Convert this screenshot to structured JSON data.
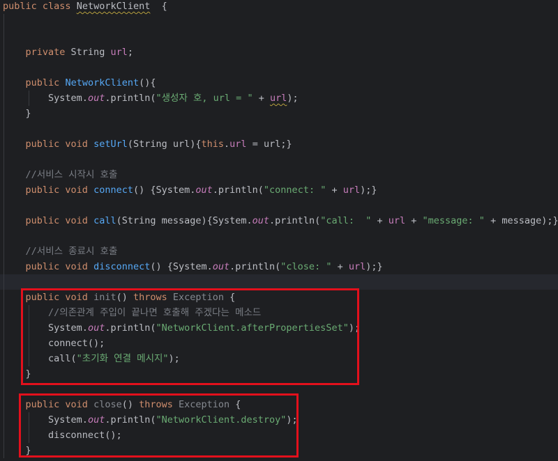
{
  "editor": {
    "language": "java",
    "colors": {
      "background": "#1e1f22",
      "keyword": "#cf8e6d",
      "function": "#56a8f5",
      "field": "#c77dbb",
      "string": "#6aab73",
      "comment": "#7a7e85",
      "unused": "#868a91",
      "text": "#bcbec4",
      "highlight_box": "#e3101c"
    },
    "lines": [
      {
        "tokens": [
          {
            "t": "public",
            "c": "kw"
          },
          {
            "t": " ",
            "c": "tx"
          },
          {
            "t": "class",
            "c": "kw"
          },
          {
            "t": " ",
            "c": "tx"
          },
          {
            "t": "NetworkClient",
            "c": "tx",
            "wavy": true
          },
          {
            "t": "  {",
            "c": "tx"
          }
        ]
      },
      {
        "tokens": []
      },
      {
        "tokens": []
      },
      {
        "tokens": [
          {
            "t": "    "
          },
          {
            "t": "private",
            "c": "kw"
          },
          {
            "t": " String ",
            "c": "tx"
          },
          {
            "t": "url",
            "c": "fld"
          },
          {
            "t": ";",
            "c": "tx"
          }
        ]
      },
      {
        "tokens": []
      },
      {
        "tokens": [
          {
            "t": "    "
          },
          {
            "t": "public",
            "c": "kw"
          },
          {
            "t": " ",
            "c": "tx"
          },
          {
            "t": "NetworkClient",
            "c": "fn"
          },
          {
            "t": "(){",
            "c": "tx"
          }
        ]
      },
      {
        "tokens": [
          {
            "t": "        "
          },
          {
            "t": "System.",
            "c": "tx"
          },
          {
            "t": "out",
            "c": "st"
          },
          {
            "t": ".println(",
            "c": "tx"
          },
          {
            "t": "\"생성자 호, url = \"",
            "c": "str"
          },
          {
            "t": " + ",
            "c": "tx"
          },
          {
            "t": "url",
            "c": "fld",
            "wavy": true
          },
          {
            "t": ");",
            "c": "tx"
          }
        ]
      },
      {
        "tokens": [
          {
            "t": "    "
          },
          {
            "t": "}",
            "c": "tx"
          }
        ]
      },
      {
        "tokens": []
      },
      {
        "tokens": [
          {
            "t": "    "
          },
          {
            "t": "public void ",
            "c": "kw"
          },
          {
            "t": "setUrl",
            "c": "fn"
          },
          {
            "t": "(String url){",
            "c": "tx"
          },
          {
            "t": "this",
            "c": "kw"
          },
          {
            "t": ".",
            "c": "tx"
          },
          {
            "t": "url",
            "c": "fld"
          },
          {
            "t": " = url;}",
            "c": "tx"
          }
        ]
      },
      {
        "tokens": []
      },
      {
        "tokens": [
          {
            "t": "    "
          },
          {
            "t": "//서비스 시작시 호출",
            "c": "cm"
          }
        ]
      },
      {
        "tokens": [
          {
            "t": "    "
          },
          {
            "t": "public void ",
            "c": "kw"
          },
          {
            "t": "connect",
            "c": "fn"
          },
          {
            "t": "() {System.",
            "c": "tx"
          },
          {
            "t": "out",
            "c": "st"
          },
          {
            "t": ".println(",
            "c": "tx"
          },
          {
            "t": "\"connect: \"",
            "c": "str"
          },
          {
            "t": " + ",
            "c": "tx"
          },
          {
            "t": "url",
            "c": "fld"
          },
          {
            "t": ");}",
            "c": "tx"
          }
        ]
      },
      {
        "tokens": []
      },
      {
        "tokens": [
          {
            "t": "    "
          },
          {
            "t": "public void ",
            "c": "kw"
          },
          {
            "t": "call",
            "c": "fn"
          },
          {
            "t": "(String message){System.",
            "c": "tx"
          },
          {
            "t": "out",
            "c": "st"
          },
          {
            "t": ".println(",
            "c": "tx"
          },
          {
            "t": "\"call:  \"",
            "c": "str"
          },
          {
            "t": " + ",
            "c": "tx"
          },
          {
            "t": "url",
            "c": "fld"
          },
          {
            "t": " + ",
            "c": "tx"
          },
          {
            "t": "\"message: \"",
            "c": "str"
          },
          {
            "t": " + message);}",
            "c": "tx"
          }
        ]
      },
      {
        "tokens": []
      },
      {
        "tokens": [
          {
            "t": "    "
          },
          {
            "t": "//서비스 종료시 호출",
            "c": "cm"
          }
        ]
      },
      {
        "tokens": [
          {
            "t": "    "
          },
          {
            "t": "public void ",
            "c": "kw"
          },
          {
            "t": "disconnect",
            "c": "fn"
          },
          {
            "t": "() {System.",
            "c": "tx"
          },
          {
            "t": "out",
            "c": "st"
          },
          {
            "t": ".println(",
            "c": "tx"
          },
          {
            "t": "\"close: \"",
            "c": "str"
          },
          {
            "t": " + ",
            "c": "tx"
          },
          {
            "t": "url",
            "c": "fld"
          },
          {
            "t": ");}",
            "c": "tx"
          }
        ]
      },
      {
        "tokens": [],
        "current": true
      },
      {
        "tokens": [
          {
            "t": "    "
          },
          {
            "t": "public void ",
            "c": "kw"
          },
          {
            "t": "init",
            "c": "un"
          },
          {
            "t": "() ",
            "c": "tx"
          },
          {
            "t": "throws ",
            "c": "kw"
          },
          {
            "t": "Exception",
            "c": "un"
          },
          {
            "t": " {",
            "c": "tx"
          }
        ]
      },
      {
        "tokens": [
          {
            "t": "        "
          },
          {
            "t": "//의존관계 주입이 끝나면 호출해 주겠다는 메소드",
            "c": "cm"
          }
        ]
      },
      {
        "tokens": [
          {
            "t": "        "
          },
          {
            "t": "System.",
            "c": "tx"
          },
          {
            "t": "out",
            "c": "st"
          },
          {
            "t": ".println(",
            "c": "tx"
          },
          {
            "t": "\"NetworkClient.afterPropertiesSet\"",
            "c": "str"
          },
          {
            "t": ");",
            "c": "tx"
          }
        ]
      },
      {
        "tokens": [
          {
            "t": "        "
          },
          {
            "t": "connect();",
            "c": "tx"
          }
        ]
      },
      {
        "tokens": [
          {
            "t": "        "
          },
          {
            "t": "call(",
            "c": "tx"
          },
          {
            "t": "\"초기화 연결 메시지\"",
            "c": "str"
          },
          {
            "t": ");",
            "c": "tx"
          }
        ]
      },
      {
        "tokens": [
          {
            "t": "    "
          },
          {
            "t": "}",
            "c": "tx"
          }
        ]
      },
      {
        "tokens": []
      },
      {
        "tokens": [
          {
            "t": "    "
          },
          {
            "t": "public void ",
            "c": "kw"
          },
          {
            "t": "close",
            "c": "un"
          },
          {
            "t": "() ",
            "c": "tx"
          },
          {
            "t": "throws ",
            "c": "kw"
          },
          {
            "t": "Exception",
            "c": "un"
          },
          {
            "t": " {",
            "c": "tx"
          }
        ]
      },
      {
        "tokens": [
          {
            "t": "        "
          },
          {
            "t": "System.",
            "c": "tx"
          },
          {
            "t": "out",
            "c": "st"
          },
          {
            "t": ".println(",
            "c": "tx"
          },
          {
            "t": "\"NetworkClient.destroy\"",
            "c": "str"
          },
          {
            "t": ");",
            "c": "tx"
          }
        ]
      },
      {
        "tokens": [
          {
            "t": "        "
          },
          {
            "t": "disconnect();",
            "c": "tx"
          }
        ]
      },
      {
        "tokens": [
          {
            "t": "    "
          },
          {
            "t": "}",
            "c": "tx"
          }
        ]
      }
    ]
  }
}
